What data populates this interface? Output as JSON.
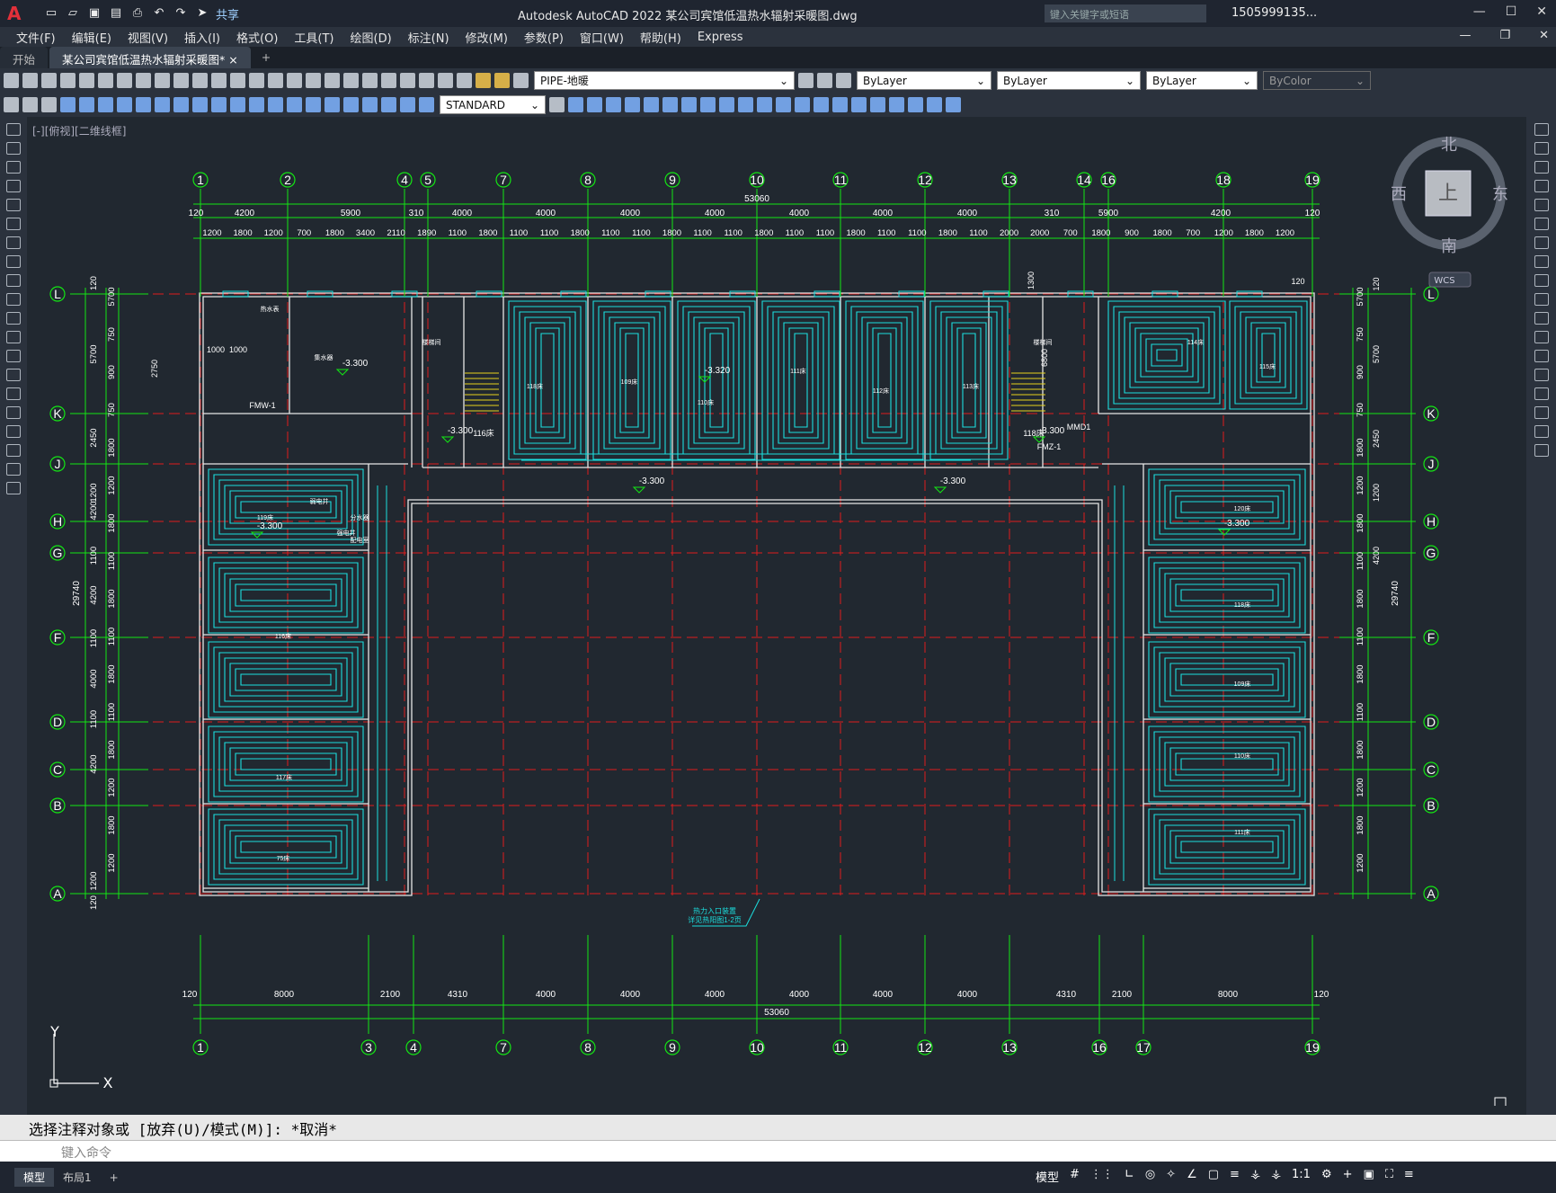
{
  "app_title": "Autodesk AutoCAD 2022    某公司宾馆低温热水辐射采暖图.dwg",
  "share_label": "共享",
  "search_placeholder": "键入关键字或短语",
  "user_label": "1505999135...",
  "menu": [
    "文件(F)",
    "编辑(E)",
    "视图(V)",
    "插入(I)",
    "格式(O)",
    "工具(T)",
    "绘图(D)",
    "标注(N)",
    "修改(M)",
    "参数(P)",
    "窗口(W)",
    "帮助(H)",
    "Express"
  ],
  "tabs": {
    "start": "开始",
    "drawing": "某公司宾馆低温热水辐射采暖图*",
    "close": "×",
    "add": "+"
  },
  "layer_combo": "PIPE-地暖",
  "color_combo": "ByLayer",
  "linetype_combo": "ByLayer",
  "lineweight_combo": "ByLayer",
  "plotstyle_combo": "ByColor",
  "textstyle_combo": "STANDARD",
  "viewport_label": "[-][俯视][二维线框]",
  "compass": {
    "n": "北",
    "s": "南",
    "e": "东",
    "w": "西",
    "center": "上",
    "wcs": "WCS"
  },
  "ucs": {
    "x": "X",
    "y": "Y"
  },
  "drawing": {
    "top_axes": [
      "1",
      "2",
      "4",
      "5",
      "7",
      "8",
      "9",
      "10",
      "11",
      "12",
      "13",
      "14",
      "16",
      "18",
      "19"
    ],
    "bottom_axes": [
      "1",
      "3",
      "4",
      "7",
      "8",
      "9",
      "10",
      "11",
      "12",
      "13",
      "16",
      "17",
      "19"
    ],
    "row_axes": [
      "L",
      "K",
      "J",
      "H",
      "G",
      "F",
      "D",
      "C",
      "B",
      "A"
    ],
    "total_width": "53060",
    "total_height": "29740",
    "top_dims": [
      "120",
      "4200",
      "5900",
      "310",
      "4000",
      "4000",
      "4000",
      "4000",
      "4000",
      "4000",
      "4000",
      "310",
      "5900",
      "4200",
      "120"
    ],
    "top_dims2": [
      "1200",
      "1800",
      "1200",
      "700",
      "1800",
      "3400",
      "2110",
      "1890",
      "1100",
      "1800",
      "1100",
      "1100",
      "1800",
      "1100",
      "1100",
      "1800",
      "1100",
      "1100",
      "1800",
      "1100",
      "1100",
      "1800",
      "1100",
      "1100",
      "1800",
      "1100",
      "2000",
      "2000",
      "700",
      "1800",
      "900",
      "1800",
      "700",
      "1200",
      "1800",
      "1200"
    ],
    "bottom_dims": [
      "120",
      "8000",
      "2100",
      "4310",
      "4000",
      "4000",
      "4000",
      "4000",
      "4000",
      "4000",
      "4310",
      "2100",
      "8000",
      "120"
    ],
    "left_dims": [
      "120",
      "5700",
      "2450",
      "1200",
      "4200",
      "1100",
      "4200",
      "1100",
      "4000",
      "1100",
      "4200",
      "1200",
      "120"
    ],
    "left_dims2": [
      "5700",
      "750",
      "900",
      "750",
      "1800",
      "1200",
      "1800",
      "1100",
      "1800",
      "1100",
      "1800",
      "1100",
      "1800",
      "1200",
      "1800",
      "1200"
    ],
    "elevations": [
      "-3.300",
      "-3.300",
      "-3.320",
      "-3.300",
      "-3.300",
      "-3.300",
      "-3.300",
      "-3.300"
    ],
    "room_labels": [
      "118床",
      "109床",
      "110床",
      "111床",
      "112床",
      "113床",
      "114床",
      "115床",
      "116床",
      "117床",
      "75床",
      "119床",
      "120床"
    ],
    "door_labels": [
      "FMW-1",
      "FMZ-1",
      "MMD1",
      "116床",
      "118床"
    ],
    "entry_note": [
      "热力入口装置",
      "详见热阳图1-2页"
    ],
    "small_labels": [
      "热水表",
      "集水器",
      "分水器",
      "配电室",
      "强电井",
      "弱电井",
      "楼梯间",
      "楼梯间"
    ],
    "dim_extra": [
      "2750",
      "1300",
      "6800",
      "1000",
      "1000",
      "120",
      "120",
      "5700",
      "2450",
      "1200",
      "4200"
    ]
  },
  "command_history": "选择注释对象或 [放弃(U)/模式(M)]: *取消*",
  "command_placeholder": "键入命令",
  "layout_tabs": [
    "模型",
    "布局1",
    "+"
  ],
  "status": {
    "model": "模型",
    "scale": "1:1"
  },
  "colors": {
    "background": "#212830",
    "grid_red": "#e01c1c",
    "axis_green": "#14e614",
    "pipe_cyan": "#1cdede",
    "wall_white": "#e6e6e6",
    "stair_yellow": "#e6d21c"
  }
}
